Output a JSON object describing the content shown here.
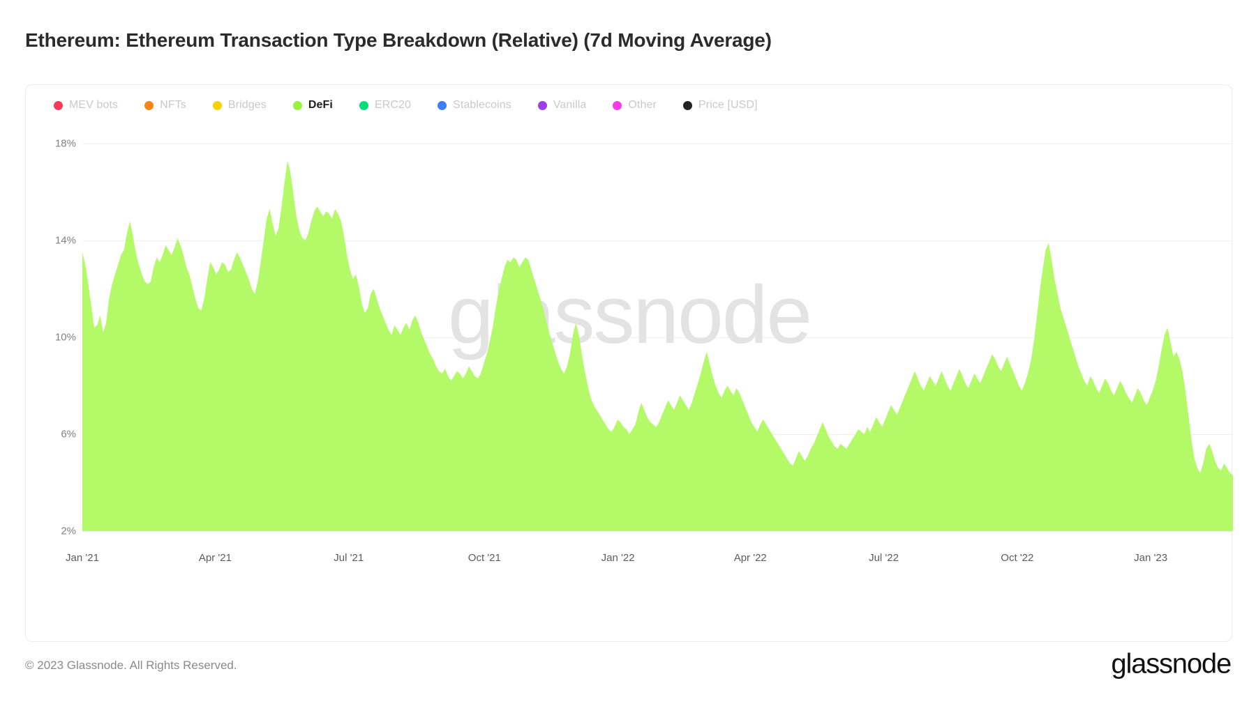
{
  "header": {
    "title": "Ethereum: Ethereum Transaction Type Breakdown (Relative) (7d Moving Average)"
  },
  "footer": {
    "copyright": "© 2023 Glassnode. All Rights Reserved.",
    "logo": "glassnode"
  },
  "watermark": "glassnode",
  "legend": {
    "items": [
      {
        "label": "MEV bots",
        "color": "#f9385a",
        "active": false
      },
      {
        "label": "NFTs",
        "color": "#f98315",
        "active": false
      },
      {
        "label": "Bridges",
        "color": "#fbd100",
        "active": false
      },
      {
        "label": "DeFi",
        "color": "#98f23c",
        "active": true
      },
      {
        "label": "ERC20",
        "color": "#00de78",
        "active": false
      },
      {
        "label": "Stablecoins",
        "color": "#3d7efc",
        "active": false
      },
      {
        "label": "Vanilla",
        "color": "#a23ce8",
        "active": false
      },
      {
        "label": "Other",
        "color": "#f93ce8",
        "active": false
      },
      {
        "label": "Price [USD]",
        "color": "#222222",
        "active": false
      }
    ]
  },
  "chart_data": {
    "type": "area",
    "title": "Ethereum: Ethereum Transaction Type Breakdown (Relative) (7d Moving Average)",
    "xlabel": "",
    "ylabel": "",
    "ylim": [
      2,
      18
    ],
    "yticks": [
      2,
      6,
      10,
      14,
      18
    ],
    "ytick_labels": [
      "2%",
      "6%",
      "10%",
      "14%",
      "18%"
    ],
    "xtick_labels": [
      "Jan '21",
      "Apr '21",
      "Jul '21",
      "Oct '21",
      "Jan '22",
      "Apr '22",
      "Jul '22",
      "Oct '22",
      "Jan '23"
    ],
    "xtick_positions": [
      0.0,
      0.1155,
      0.2315,
      0.3495,
      0.4655,
      0.5805,
      0.6965,
      0.8125,
      0.9285
    ],
    "grid": true,
    "legend_position": "top-left",
    "fill_color": "#b4fa68",
    "series": [
      {
        "name": "DeFi",
        "unit": "%",
        "values": [
          13.5,
          13.0,
          12.2,
          11.3,
          10.4,
          10.5,
          10.9,
          10.2,
          10.6,
          11.6,
          12.2,
          12.6,
          13.0,
          13.4,
          13.6,
          14.3,
          14.8,
          14.2,
          13.5,
          13.0,
          12.6,
          12.3,
          12.2,
          12.3,
          12.9,
          13.3,
          13.1,
          13.4,
          13.8,
          13.6,
          13.4,
          13.7,
          14.1,
          13.8,
          13.4,
          12.9,
          12.6,
          12.1,
          11.6,
          11.2,
          11.1,
          11.6,
          12.4,
          13.1,
          12.9,
          12.6,
          12.8,
          13.1,
          13.0,
          12.7,
          12.8,
          13.2,
          13.5,
          13.3,
          13.0,
          12.7,
          12.4,
          12.0,
          11.8,
          12.3,
          13.1,
          14.0,
          14.9,
          15.3,
          14.7,
          14.2,
          14.5,
          15.4,
          16.4,
          17.3,
          16.8,
          15.9,
          15.0,
          14.4,
          14.1,
          14.0,
          14.3,
          14.8,
          15.2,
          15.4,
          15.2,
          15.0,
          15.2,
          15.1,
          14.9,
          15.3,
          15.1,
          14.8,
          14.2,
          13.4,
          12.8,
          12.4,
          12.6,
          12.1,
          11.4,
          11.0,
          11.2,
          11.8,
          12.0,
          11.6,
          11.2,
          10.9,
          10.6,
          10.3,
          10.1,
          10.5,
          10.3,
          10.1,
          10.4,
          10.6,
          10.3,
          10.7,
          10.9,
          10.6,
          10.2,
          9.9,
          9.6,
          9.3,
          9.1,
          8.8,
          8.6,
          8.5,
          8.7,
          8.4,
          8.2,
          8.4,
          8.6,
          8.5,
          8.3,
          8.5,
          8.8,
          8.6,
          8.4,
          8.3,
          8.5,
          8.9,
          9.3,
          9.8,
          10.4,
          11.2,
          11.9,
          12.4,
          12.9,
          13.2,
          13.1,
          13.3,
          13.2,
          12.9,
          13.1,
          13.3,
          13.2,
          12.8,
          12.4,
          12.0,
          11.6,
          11.2,
          10.7,
          10.2,
          9.8,
          9.4,
          9.0,
          8.7,
          8.5,
          8.8,
          9.3,
          10.1,
          10.6,
          10.1,
          9.3,
          8.6,
          8.0,
          7.5,
          7.2,
          7.0,
          6.8,
          6.6,
          6.4,
          6.2,
          6.1,
          6.3,
          6.6,
          6.5,
          6.3,
          6.2,
          6.0,
          6.2,
          6.4,
          6.9,
          7.3,
          7.0,
          6.7,
          6.5,
          6.4,
          6.3,
          6.5,
          6.8,
          7.1,
          7.4,
          7.2,
          7.0,
          7.3,
          7.6,
          7.4,
          7.2,
          7.0,
          7.3,
          7.7,
          8.1,
          8.5,
          9.0,
          9.4,
          8.9,
          8.4,
          8.0,
          7.7,
          7.5,
          7.8,
          8.0,
          7.8,
          7.6,
          7.9,
          7.7,
          7.4,
          7.1,
          6.8,
          6.5,
          6.3,
          6.1,
          6.4,
          6.6,
          6.4,
          6.2,
          6.0,
          5.8,
          5.6,
          5.4,
          5.2,
          5.0,
          4.8,
          4.7,
          5.0,
          5.3,
          5.1,
          4.9,
          5.1,
          5.4,
          5.6,
          5.9,
          6.2,
          6.5,
          6.2,
          5.9,
          5.7,
          5.5,
          5.4,
          5.6,
          5.5,
          5.4,
          5.6,
          5.8,
          6.0,
          6.2,
          6.1,
          6.0,
          6.3,
          6.1,
          6.4,
          6.7,
          6.5,
          6.3,
          6.6,
          6.9,
          7.2,
          7.0,
          6.8,
          7.1,
          7.4,
          7.7,
          8.0,
          8.3,
          8.6,
          8.3,
          8.0,
          7.8,
          8.1,
          8.4,
          8.2,
          8.0,
          8.3,
          8.6,
          8.3,
          8.0,
          7.8,
          8.1,
          8.4,
          8.7,
          8.4,
          8.1,
          7.9,
          8.2,
          8.5,
          8.3,
          8.1,
          8.4,
          8.7,
          9.0,
          9.3,
          9.1,
          8.8,
          8.6,
          8.9,
          9.2,
          8.9,
          8.6,
          8.3,
          8.0,
          7.8,
          8.1,
          8.5,
          9.0,
          9.8,
          10.8,
          11.9,
          12.8,
          13.6,
          13.9,
          13.2,
          12.4,
          11.8,
          11.2,
          10.8,
          10.4,
          10.0,
          9.6,
          9.2,
          8.8,
          8.5,
          8.2,
          8.0,
          8.4,
          8.2,
          7.9,
          7.7,
          8.0,
          8.3,
          8.1,
          7.8,
          7.6,
          7.9,
          8.2,
          8.0,
          7.7,
          7.5,
          7.3,
          7.6,
          7.9,
          7.7,
          7.4,
          7.2,
          7.5,
          7.8,
          8.2,
          8.8,
          9.5,
          10.1,
          10.4,
          9.8,
          9.2,
          9.4,
          9.1,
          8.6,
          7.8,
          6.8,
          5.8,
          5.0,
          4.6,
          4.4,
          4.8,
          5.4,
          5.6,
          5.3,
          4.9,
          4.6,
          4.5,
          4.8,
          4.6,
          4.4,
          4.3
        ]
      }
    ]
  }
}
